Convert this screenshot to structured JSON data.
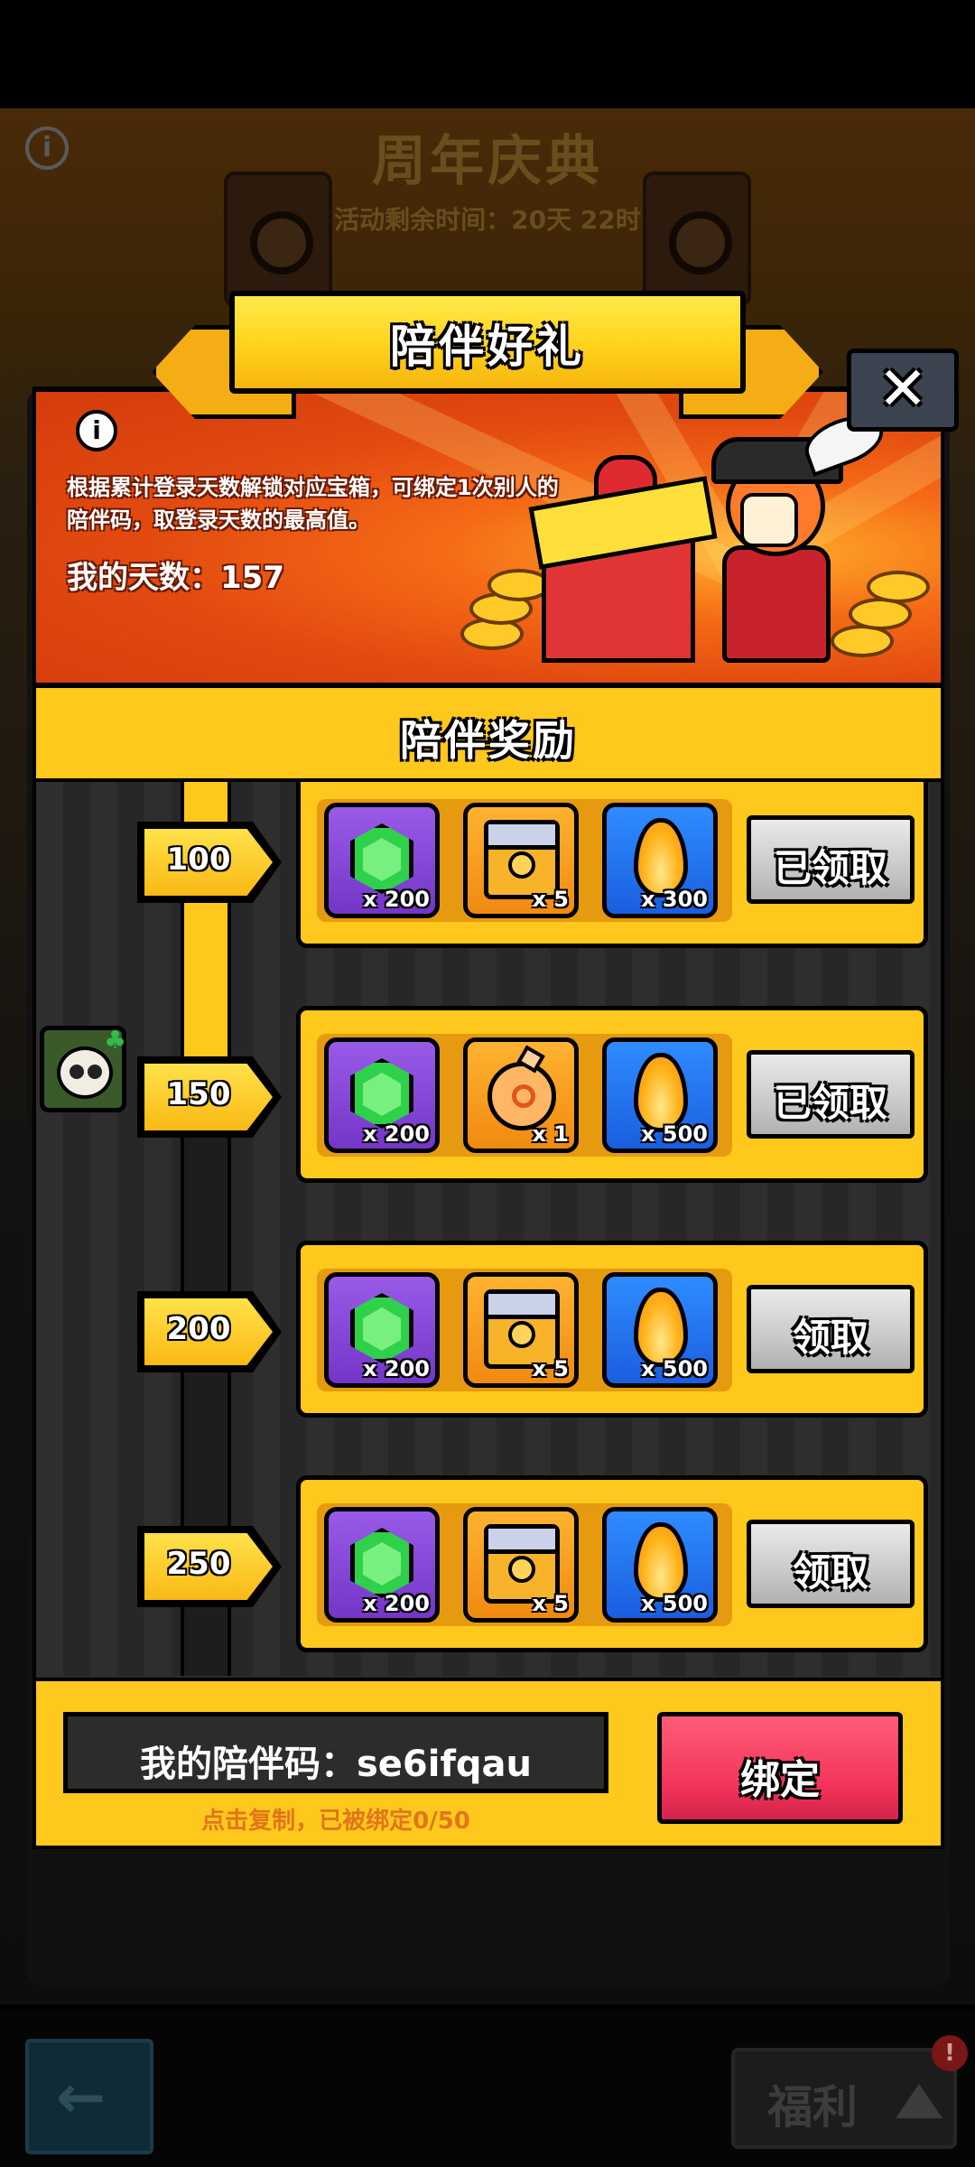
{
  "background": {
    "title": "周年庆典",
    "timer": "活动剩余时间：20天 22时",
    "info_icon": "info-icon"
  },
  "modal": {
    "title": "陪伴好礼",
    "close_icon": "close-icon",
    "close_label": "✕",
    "hero": {
      "info_label": "i",
      "description": "根据累计登录天数解锁对应宝箱，可绑定1次别人的陪伴码，取登录天数的最高值。",
      "days": "我的天数：157"
    },
    "section_title": "陪伴奖励",
    "tiers": [
      {
        "milestone": "100",
        "items": [
          {
            "icon": "gem-icon",
            "qty": "x 200"
          },
          {
            "icon": "chest-icon",
            "qty": "x 5"
          },
          {
            "icon": "flame-icon",
            "qty": "x 300"
          }
        ],
        "button": "已领取",
        "claimed": true
      },
      {
        "milestone": "150",
        "items": [
          {
            "icon": "gem-icon",
            "qty": "x 200"
          },
          {
            "icon": "potion-icon",
            "qty": "x 1"
          },
          {
            "icon": "flame-icon",
            "qty": "x 500"
          }
        ],
        "button": "已领取",
        "claimed": true
      },
      {
        "milestone": "200",
        "items": [
          {
            "icon": "gem-icon",
            "qty": "x 200"
          },
          {
            "icon": "chest-icon",
            "qty": "x 5"
          },
          {
            "icon": "flame-icon",
            "qty": "x 500"
          }
        ],
        "button": "领取",
        "claimed": false
      },
      {
        "milestone": "250",
        "items": [
          {
            "icon": "gem-icon",
            "qty": "x 200"
          },
          {
            "icon": "chest-icon",
            "qty": "x 5"
          },
          {
            "icon": "flame-icon",
            "qty": "x 500"
          }
        ],
        "button": "领取",
        "claimed": false
      }
    ],
    "footer": {
      "code_text": "我的陪伴码：se6ifqau",
      "hint": "点击复制，已被绑定0/50",
      "bind_button": "绑定"
    }
  },
  "bottom_bar": {
    "back_icon": "back-arrow-icon",
    "welfare_label": "福利",
    "welfare_badge": "!"
  },
  "colors": {
    "accent_yellow": "#ffc81c",
    "bind_red": "#f2325a",
    "hero_orange": "#e24a10"
  }
}
